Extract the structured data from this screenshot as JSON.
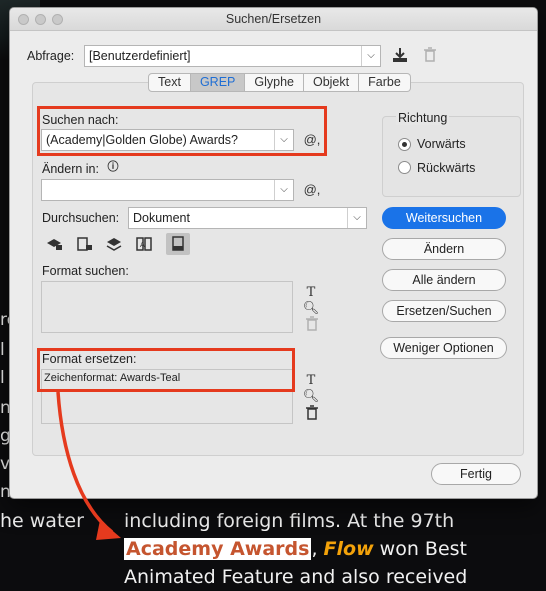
{
  "window": {
    "title": "Suchen/Ersetzen"
  },
  "query": {
    "label": "Abfrage:",
    "value": "[Benutzerdefiniert]"
  },
  "tabs": [
    {
      "label": "Text",
      "active": false
    },
    {
      "label": "GREP",
      "active": true
    },
    {
      "label": "Glyphe",
      "active": false
    },
    {
      "label": "Objekt",
      "active": false
    },
    {
      "label": "Farbe",
      "active": false
    }
  ],
  "find": {
    "label": "Suchen nach:",
    "value": "(Academy|Golden Globe) Awards?"
  },
  "change": {
    "label": "Ändern in:",
    "value": ""
  },
  "search_in": {
    "label": "Durchsuchen:",
    "value": "Dokument"
  },
  "direction": {
    "title": "Richtung",
    "options": [
      {
        "label": "Vorwärts",
        "selected": true
      },
      {
        "label": "Rückwärts",
        "selected": false
      }
    ]
  },
  "buttons": {
    "find_next": "Weitersuchen",
    "change": "Ändern",
    "change_all": "Alle ändern",
    "change_find": "Ersetzen/Suchen",
    "fewer_options": "Weniger Optionen",
    "done": "Fertig"
  },
  "find_format": {
    "label": "Format suchen:"
  },
  "change_format": {
    "label": "Format ersetzen:",
    "value": "Zeichenformat: Awards-Teal"
  },
  "background": {
    "line1": "including foreign films. At the 97th",
    "line1_left": "he water",
    "line2_highlight": "Academy Awards",
    "line2_comma": ",",
    "line2_italic": "Flow",
    "line2_rest": " won Best",
    "line3": "Animated Feature and also received"
  },
  "colors": {
    "accent": "#1a73e8",
    "annotation_red": "#e53a1e",
    "highlight_text": "#c5552f",
    "flow_orange": "#f3a20a"
  }
}
